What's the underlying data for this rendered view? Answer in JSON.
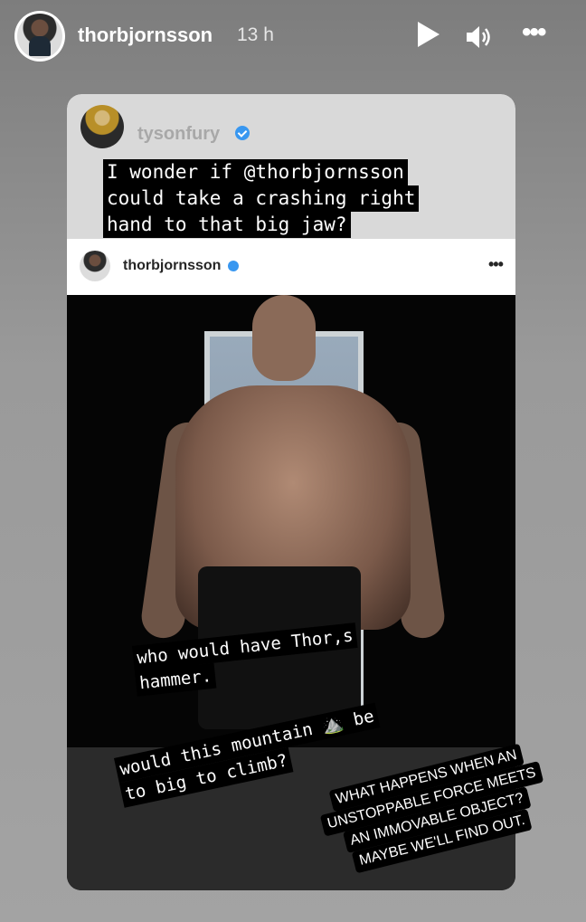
{
  "header": {
    "username": "thorbjornsson",
    "time": "13 h",
    "icons": [
      "play-icon",
      "volume-icon",
      "more-icon"
    ]
  },
  "quoted_post": {
    "author": "tysonfury",
    "verified": true,
    "caption_lines": [
      "I wonder if @thorbjornsson",
      "could take a crashing right",
      "hand to that big jaw?"
    ]
  },
  "embedded_post": {
    "author": "thorbjornsson",
    "verified": true,
    "more_icon": "more-icon"
  },
  "overlays": {
    "text1_lines": [
      "who would have Thor,s",
      "hammer."
    ],
    "text2_lines": [
      "would this mountain ⛰️ be",
      "to big to climb?"
    ],
    "quote_lines": [
      "WHAT HAPPENS WHEN AN",
      "UNSTOPPABLE FORCE MEETS",
      "AN IMMOVABLE OBJECT?",
      "MAYBE WE'LL FIND OUT."
    ]
  },
  "colors": {
    "verified_badge": "#3897f0",
    "overlay_bg": "#000000"
  }
}
